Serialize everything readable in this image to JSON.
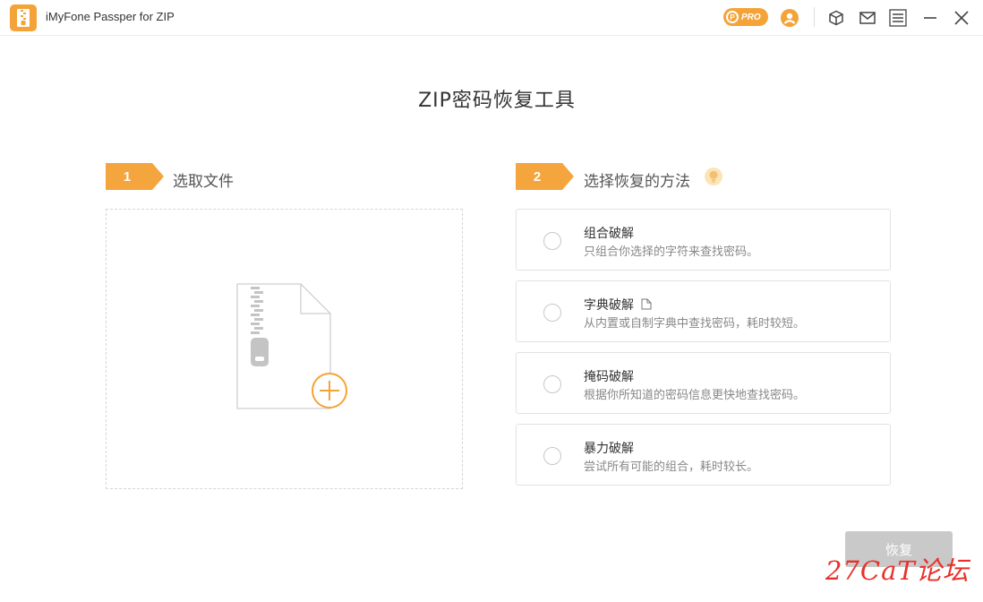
{
  "window": {
    "title": "iMyFone Passper for ZIP",
    "pro_badge": "PRO",
    "pro_coin": "P"
  },
  "page": {
    "title": "ZIP密码恢复工具"
  },
  "step1": {
    "number": "1",
    "label": "选取文件"
  },
  "step2": {
    "number": "2",
    "label": "选择恢复的方法"
  },
  "methods": [
    {
      "name": "组合破解",
      "desc": "只组合你选择的字符来查找密码。"
    },
    {
      "name": "字典破解",
      "desc": "从内置或自制字典中查找密码，耗时较短。"
    },
    {
      "name": "掩码破解",
      "desc": "根据你所知道的密码信息更快地查找密码。"
    },
    {
      "name": "暴力破解",
      "desc": "尝试所有可能的组合，耗时较长。"
    }
  ],
  "recover_button": "恢复",
  "watermark": "27CaT论坛",
  "colors": {
    "accent": "#f4a338",
    "step_tag": "#f4a53d",
    "button_disabled": "#c9c9c9",
    "watermark": "#e8312a"
  },
  "icons": [
    "app-logo-icon",
    "pro-coin-icon",
    "account-icon",
    "cube-icon",
    "mail-icon",
    "menu-icon",
    "minimize-icon",
    "close-icon",
    "hint-bulb-icon",
    "zip-file-icon",
    "add-plus-icon",
    "document-icon"
  ]
}
